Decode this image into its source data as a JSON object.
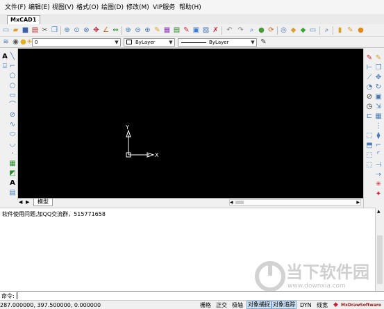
{
  "menu": [
    "文件(F)",
    "编辑(E)",
    "视图(V)",
    "格式(O)",
    "绘图(D)",
    "修改(M)",
    "VIP服务",
    "帮助(H)"
  ],
  "document_tab": "MxCAD1",
  "layer_combo": "0",
  "color_combo": "ByLayer",
  "linetype_combo": "ByLayer",
  "layout_tab": "模型",
  "command_history": [
    "软件使用问题,加QQ交流群，515771658"
  ],
  "command_prompt": "命令:",
  "coordinates": "287.000000,  397.500000,  0.000000",
  "status_toggles": [
    {
      "label": "栅格",
      "active": false
    },
    {
      "label": "正交",
      "active": false
    },
    {
      "label": "极轴",
      "active": false
    },
    {
      "label": "对象捕捉",
      "active": true
    },
    {
      "label": "对象追踪",
      "active": true
    },
    {
      "label": "DYN",
      "active": false
    },
    {
      "label": "线宽",
      "active": false
    }
  ],
  "status_brand": "MxDrawSoftware",
  "ucs_labels": {
    "x": "X",
    "y": "Y"
  },
  "watermark_title": "当下软件园",
  "watermark_url": "www.downxia.com",
  "colors": {
    "canvas": "#000000",
    "ucs": "#ffffff",
    "active_toggle": "#cfe3f7"
  }
}
